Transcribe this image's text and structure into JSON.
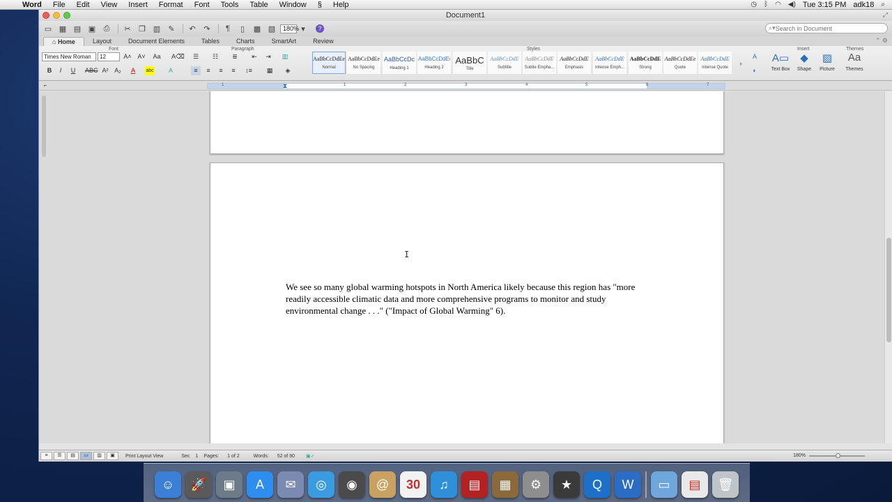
{
  "menubar": {
    "app_name": "Word",
    "items": [
      "File",
      "Edit",
      "View",
      "Insert",
      "Format",
      "Font",
      "Tools",
      "Table",
      "Window",
      "Help"
    ],
    "clock": "Tue 3:15 PM",
    "user": "adk18"
  },
  "window": {
    "title": "Document1",
    "zoom": "180%",
    "search_placeholder": "Search in Document"
  },
  "ribbon": {
    "tabs": [
      "Home",
      "Layout",
      "Document Elements",
      "Tables",
      "Charts",
      "SmartArt",
      "Review"
    ],
    "active_tab": "Home",
    "group_labels": {
      "font": "Font",
      "paragraph": "Paragraph",
      "styles": "Styles",
      "insert": "Insert",
      "themes": "Themes"
    },
    "font_name": "Times New Roman",
    "font_size": "12",
    "styles": [
      {
        "sample": "AaBbCcDdEe",
        "name": "Normal"
      },
      {
        "sample": "AaBbCcDdEe",
        "name": "No Spacing"
      },
      {
        "sample": "AaBbCcDc",
        "name": "Heading 1"
      },
      {
        "sample": "AaBbCcDdEe",
        "name": "Heading 2"
      },
      {
        "sample": "AaBbC",
        "name": "Title"
      },
      {
        "sample": "AaBbCcDdE",
        "name": "Subtitle"
      },
      {
        "sample": "AaBbCcDdE",
        "name": "Subtle Empha..."
      },
      {
        "sample": "AaBbCcDdE",
        "name": "Emphasis"
      },
      {
        "sample": "AaBbCcDdE",
        "name": "Intense Emph..."
      },
      {
        "sample": "AaBbCcDdE",
        "name": "Strong"
      },
      {
        "sample": "AaBbCcDdEe",
        "name": "Quote"
      },
      {
        "sample": "AaBbCcDdE",
        "name": "Intense Quote"
      }
    ],
    "insert_buttons": [
      "Text Box",
      "Shape",
      "Picture"
    ],
    "themes_button": "Themes"
  },
  "ruler_numbers": [
    "1",
    "1",
    "2",
    "3",
    "4",
    "5",
    "6",
    "7"
  ],
  "document": {
    "body": "We see so many global warming hotspots in North America likely because this region has \"more readily accessible climatic data and more comprehensive programs to monitor and study environmental change . . .\" (\"Impact of Global Warming\" 6)."
  },
  "statusbar": {
    "view_name": "Print Layout View",
    "sec_label": "Sec",
    "sec_value": "1",
    "pages_label": "Pages:",
    "pages_value": "1 of 2",
    "words_label": "Words:",
    "words_value": "52 of 90",
    "zoom": "180%"
  },
  "dock": {
    "icons": [
      {
        "name": "finder",
        "color": "#3b7fd6",
        "glyph": "☺"
      },
      {
        "name": "launchpad",
        "color": "#5a5a5a",
        "glyph": "🚀"
      },
      {
        "name": "preview",
        "color": "#6d7a88",
        "glyph": "▣"
      },
      {
        "name": "app-store",
        "color": "#2d8ef0",
        "glyph": "A"
      },
      {
        "name": "mail",
        "color": "#7a8ab0",
        "glyph": "✉"
      },
      {
        "name": "safari",
        "color": "#3a9be0",
        "glyph": "◎"
      },
      {
        "name": "facetime",
        "color": "#4a4a4a",
        "glyph": "◉"
      },
      {
        "name": "contacts",
        "color": "#c9a262",
        "glyph": "@"
      },
      {
        "name": "calendar",
        "color": "#f2f2f2",
        "glyph": "30"
      },
      {
        "name": "itunes",
        "color": "#2f8fd8",
        "glyph": "♫"
      },
      {
        "name": "photo-booth",
        "color": "#b32222",
        "glyph": "▤"
      },
      {
        "name": "iphoto",
        "color": "#8a6a3a",
        "glyph": "▦"
      },
      {
        "name": "system-preferences",
        "color": "#8e8e8e",
        "glyph": "⚙"
      },
      {
        "name": "imovie",
        "color": "#3a3a3a",
        "glyph": "★"
      },
      {
        "name": "quicktime",
        "color": "#1e6fc8",
        "glyph": "Q"
      },
      {
        "name": "word",
        "color": "#2b6cc4",
        "glyph": "W"
      },
      {
        "name": "documents-folder",
        "color": "#6fa6dc",
        "glyph": "▭"
      },
      {
        "name": "document-stack",
        "color": "#e9e9e9",
        "glyph": "▤"
      },
      {
        "name": "trash",
        "color": "#bfc4c8",
        "glyph": "🗑"
      }
    ]
  }
}
